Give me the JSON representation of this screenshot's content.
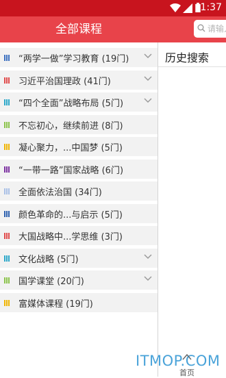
{
  "status_bar": {
    "time": "1:37"
  },
  "header": {
    "left_title": "全部课程",
    "search_placeholder": "请输入"
  },
  "course_list": [
    {
      "label": "“两学一做”学习教育 (19门)",
      "color": "#3b6fbf",
      "expanded_icon": true
    },
    {
      "label": "习近平治国理政 (41门)",
      "color": "#e04a4a",
      "expanded_icon": true
    },
    {
      "label": "“四个全面”战略布局 (5门)",
      "color": "#2aa7c9",
      "expanded_icon": true
    },
    {
      "label": "不忘初心，继续前进 (8门)",
      "color": "#8bc34a",
      "expanded_icon": false
    },
    {
      "label": "凝心聚力，...中国梦 (5门)",
      "color": "#f0b400",
      "expanded_icon": false
    },
    {
      "label": "“一带一路”国家战略 (6门)",
      "color": "#7b2fa0",
      "expanded_icon": false
    },
    {
      "label": "全面依法治国 (34门)",
      "color": "#a9c0e6",
      "expanded_icon": false
    },
    {
      "label": "颜色革命的...与启示 (5门)",
      "color": "#2b5fae",
      "expanded_icon": false
    },
    {
      "label": "大国战略中...学思维 (3门)",
      "color": "#e04a4a",
      "expanded_icon": false
    },
    {
      "label": "文化战略 (5门)",
      "color": "#2aa7c9",
      "expanded_icon": true
    },
    {
      "label": "国学课堂 (20门)",
      "color": "#8bc34a",
      "expanded_icon": true
    },
    {
      "label": "富媒体课程 (19门)",
      "color": "#f0b400",
      "expanded_icon": false
    }
  ],
  "history": {
    "title": "历史搜索"
  },
  "bottom_nav": {
    "home_label": "首页"
  },
  "watermark": "ITMOP.COM",
  "colors": {
    "header": "#e8434a",
    "statusbar": "#c8141e"
  }
}
